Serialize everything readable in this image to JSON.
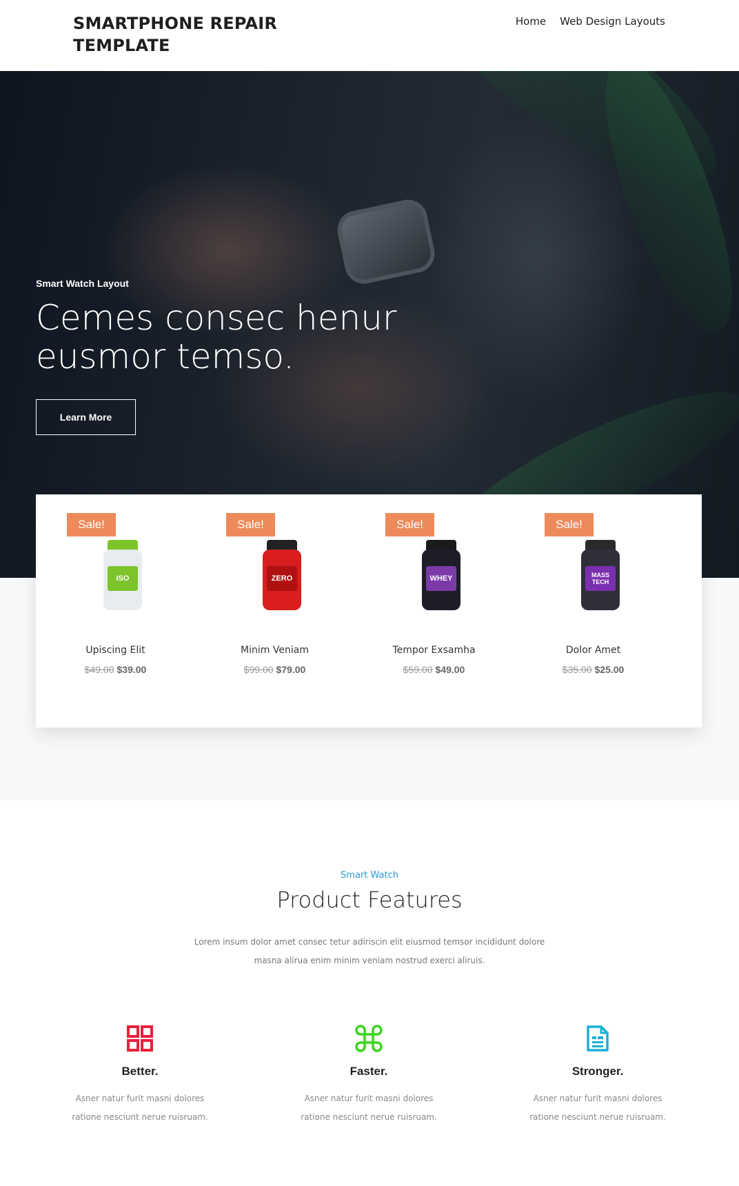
{
  "header": {
    "brand": "SMARTPHONE REPAIR TEMPLATE",
    "nav": [
      {
        "label": "Home"
      },
      {
        "label": "Web Design Layouts"
      }
    ]
  },
  "hero": {
    "eyebrow": "Smart Watch Layout",
    "title": "Cemes consec henur eusmor temso.",
    "button_label": "Learn More"
  },
  "products": [
    {
      "badge": "Sale!",
      "name": "Upiscing Elit",
      "old_price": "$49.00",
      "price": "$39.00",
      "label": "ISO",
      "colors": {
        "lid": "#7cc42a",
        "body": "#e9ecef",
        "label": "#7cc42a"
      }
    },
    {
      "badge": "Sale!",
      "name": "Minim Veniam",
      "old_price": "$99.00",
      "price": "$79.00",
      "label": "ZERO",
      "colors": {
        "lid": "#222222",
        "body": "#d81e1e",
        "label": "#b01010"
      }
    },
    {
      "badge": "Sale!",
      "name": "Tempor Exsamha",
      "old_price": "$59.00",
      "price": "$49.00",
      "label": "WHEY",
      "colors": {
        "lid": "#1a1a1a",
        "body": "#1d1d28",
        "label": "#7b3aa8"
      }
    },
    {
      "badge": "Sale!",
      "name": "Dolor Amet",
      "old_price": "$35.00",
      "price": "$25.00",
      "label": "MASS TECH",
      "colors": {
        "lid": "#2a2a2a",
        "body": "#2f2f3a",
        "label": "#7a2fb0"
      }
    }
  ],
  "features_section": {
    "eyebrow": "Smart Watch",
    "title": "Product Features",
    "description": "Lorem insum dolor amet consec tetur adiriscin elit eiusmod temsor incididunt dolore masna alirua enim minim veniam nostrud exerci aliruis."
  },
  "features": [
    {
      "icon": "grid-icon",
      "icon_color": "#e8203a",
      "title": "Better.",
      "description": "Asner natur furit masni dolores ratione nesciunt nerue ruisruam."
    },
    {
      "icon": "command-icon",
      "icon_color": "#3cd41e",
      "title": "Faster.",
      "description": "Asner natur furit masni dolores ratione nesciunt nerue ruisruam."
    },
    {
      "icon": "document-icon",
      "icon_color": "#1ab0d8",
      "title": "Stronger.",
      "description": "Asner natur furit masni dolores ratione nesciunt nerue ruisruam."
    }
  ]
}
